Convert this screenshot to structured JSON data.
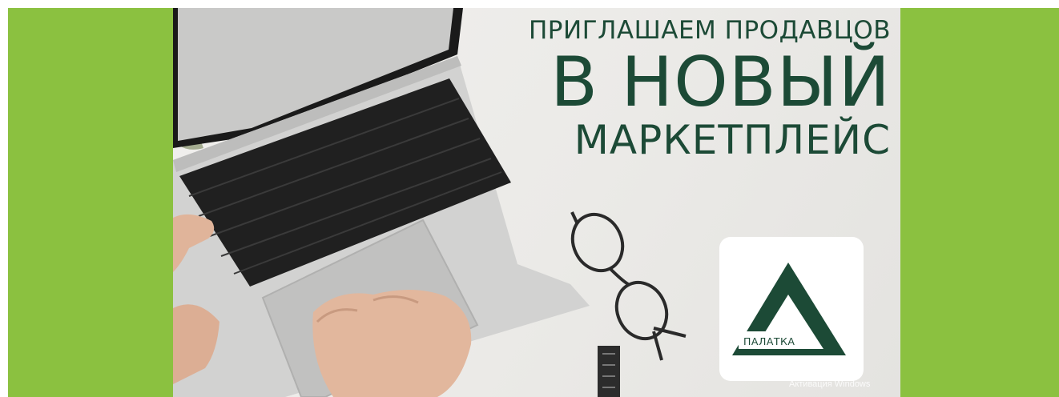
{
  "banner": {
    "headline_line1": "ПРИГЛАШАЕМ ПРОДАВЦОВ",
    "headline_line2": "В НОВЫЙ",
    "headline_line3": "МАРКЕТПЛЕЙС",
    "logo_text": "ПАЛАТКА"
  },
  "watermark": {
    "text": "Активация Windows"
  },
  "colors": {
    "side_background": "#8bc140",
    "brand_green": "#1c4a36",
    "banner_background": "#eeedea"
  },
  "icons": [
    "laptop-image",
    "glasses-image",
    "plant-image",
    "triangle-logo-icon"
  ]
}
